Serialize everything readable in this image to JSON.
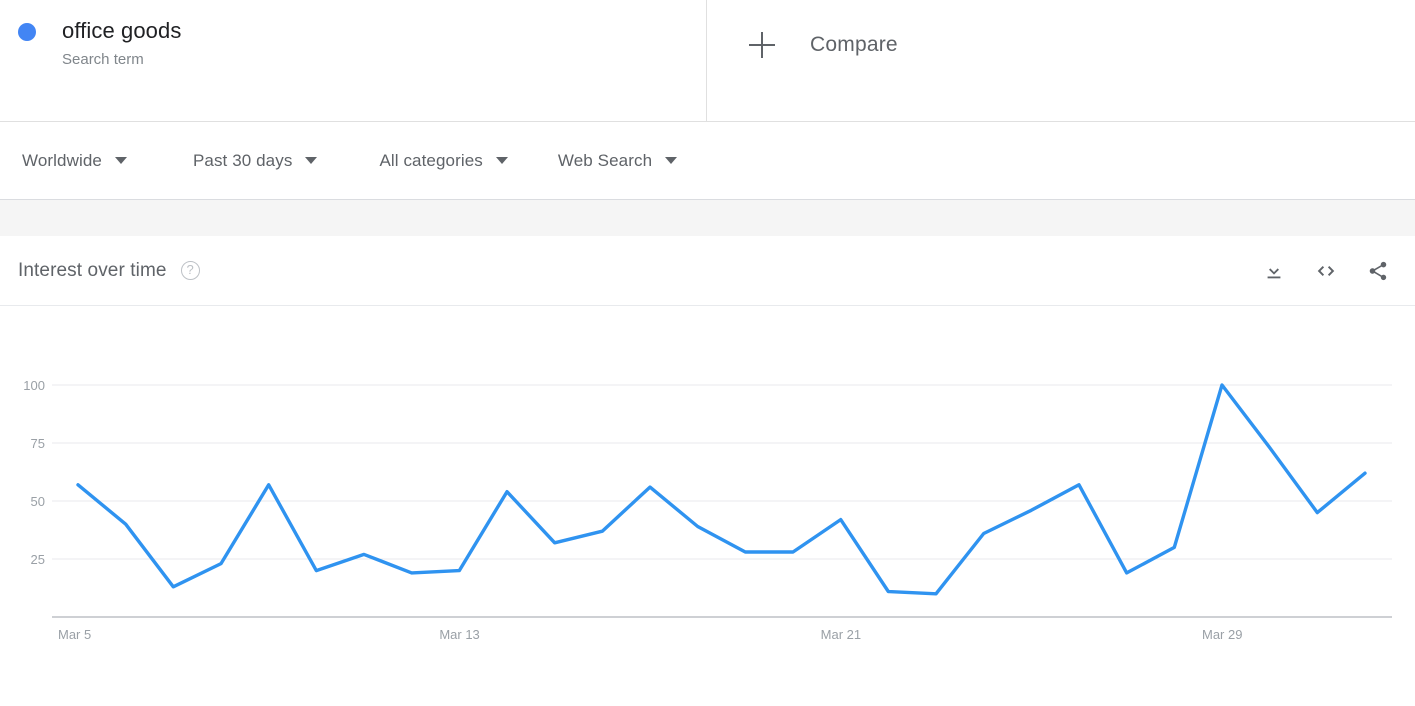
{
  "term": {
    "name": "office goods",
    "subtitle": "Search term",
    "dot_color": "#4285f4"
  },
  "compare": {
    "label": "Compare",
    "icon": "plus-icon"
  },
  "filters": [
    {
      "label": "Worldwide",
      "name": "location"
    },
    {
      "label": "Past 30 days",
      "name": "time-range"
    },
    {
      "label": "All categories",
      "name": "category"
    },
    {
      "label": "Web Search",
      "name": "search-type"
    }
  ],
  "card": {
    "title": "Interest over time",
    "help_icon": "?",
    "actions": [
      {
        "name": "download-icon",
        "label": "Download"
      },
      {
        "name": "embed-code-icon",
        "label": "Embed"
      },
      {
        "name": "share-icon",
        "label": "Share"
      }
    ]
  },
  "chart_data": {
    "type": "line",
    "title": "Interest over time",
    "xlabel": "",
    "ylabel": "",
    "ylim": [
      0,
      100
    ],
    "grid": true,
    "legend": false,
    "y_ticks": [
      100,
      75,
      50,
      25
    ],
    "x_ticks": [
      {
        "label": "Mar 5",
        "index": 0
      },
      {
        "label": "Mar 13",
        "index": 8
      },
      {
        "label": "Mar 21",
        "index": 16
      },
      {
        "label": "Mar 29",
        "index": 24
      }
    ],
    "x": [
      "Mar 5",
      "Mar 6",
      "Mar 7",
      "Mar 8",
      "Mar 9",
      "Mar 10",
      "Mar 11",
      "Mar 12",
      "Mar 13",
      "Mar 14",
      "Mar 15",
      "Mar 16",
      "Mar 17",
      "Mar 18",
      "Mar 19",
      "Mar 20",
      "Mar 21",
      "Mar 22",
      "Mar 23",
      "Mar 24",
      "Mar 25",
      "Mar 26",
      "Mar 27",
      "Mar 28",
      "Mar 29",
      "Mar 30",
      "Mar 31",
      "Mar 32"
    ],
    "series": [
      {
        "name": "office goods",
        "color": "#2f93f0",
        "values": [
          57,
          40,
          13,
          23,
          57,
          20,
          27,
          19,
          20,
          54,
          32,
          37,
          56,
          39,
          28,
          28,
          42,
          11,
          10,
          36,
          46,
          57,
          19,
          30,
          100,
          73,
          45,
          62
        ]
      }
    ]
  }
}
